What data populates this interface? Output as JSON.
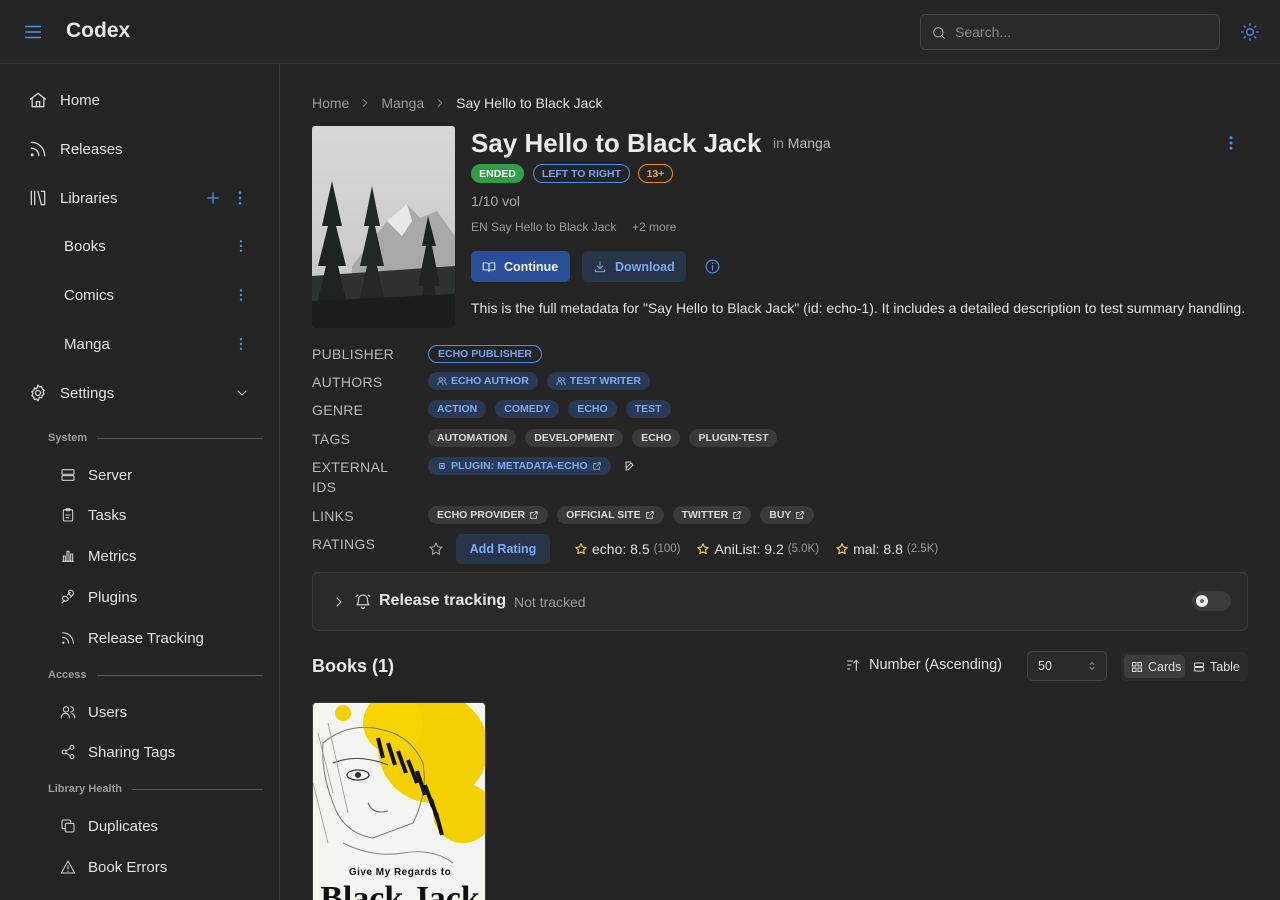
{
  "header": {
    "app_title": "Codex",
    "search_placeholder": "Search..."
  },
  "sidebar": {
    "home": "Home",
    "releases": "Releases",
    "libraries": "Libraries",
    "library_items": [
      "Books",
      "Comics",
      "Manga"
    ],
    "settings": "Settings",
    "sections": {
      "system": "System",
      "access": "Access",
      "library_health": "Library Health"
    },
    "system_items": [
      "Server",
      "Tasks",
      "Metrics",
      "Plugins",
      "Release Tracking"
    ],
    "access_items": [
      "Users",
      "Sharing Tags"
    ],
    "health_items": [
      "Duplicates",
      "Book Errors"
    ]
  },
  "breadcrumb": {
    "home": "Home",
    "library": "Manga",
    "current": "Say Hello to Black Jack"
  },
  "series": {
    "title": "Say Hello to Black Jack",
    "in_prefix": "in",
    "library": "Manga",
    "badges": {
      "status": "ENDED",
      "direction": "LEFT TO RIGHT",
      "age": "13+"
    },
    "volume_count": "1/10 vol",
    "alt_title": "EN Say Hello to Black Jack",
    "alt_more": "+2 more",
    "continue_label": "Continue",
    "download_label": "Download",
    "summary": "This is the full metadata for \"Say Hello to Black Jack\" (id: echo-1). It includes a detailed description to test summary handling."
  },
  "metadata": {
    "publisher_label": "PUBLISHER",
    "publishers": [
      "ECHO PUBLISHER"
    ],
    "authors_label": "AUTHORS",
    "authors": [
      "ECHO AUTHOR",
      "TEST WRITER"
    ],
    "genre_label": "GENRE",
    "genres": [
      "ACTION",
      "COMEDY",
      "ECHO",
      "TEST"
    ],
    "tags_label": "TAGS",
    "tags": [
      "AUTOMATION",
      "DEVELOPMENT",
      "ECHO",
      "PLUGIN-TEST"
    ],
    "external_ids_label": [
      "EXTERNAL",
      "IDS"
    ],
    "external_ids": [
      "PLUGIN: METADATA-ECHO"
    ],
    "links_label": "LINKS",
    "links": [
      "ECHO PROVIDER",
      "OFFICIAL SITE",
      "TWITTER",
      "BUY"
    ],
    "ratings_label": "RATINGS",
    "add_rating_label": "Add Rating",
    "ratings": [
      {
        "source": "echo: 8.5",
        "count": "(100)"
      },
      {
        "source": "AniList: 9.2",
        "count": "(5.0K)"
      },
      {
        "source": "mal: 8.8",
        "count": "(2.5K)"
      }
    ]
  },
  "release_tracking": {
    "title": "Release tracking",
    "status": "Not tracked"
  },
  "books": {
    "title": "Books (1)",
    "sort_label": "Number (Ascending)",
    "page_size": "50",
    "view_cards": "Cards",
    "view_table": "Table"
  },
  "book_cover_text": {
    "line1": "Give My Regards to",
    "line2": "Black Jack"
  },
  "colors": {
    "accent": "#4d8fe8",
    "background": "#242424",
    "status_green": "#2f9e44",
    "age_orange": "#f08c00",
    "star": "#f2c94c"
  }
}
